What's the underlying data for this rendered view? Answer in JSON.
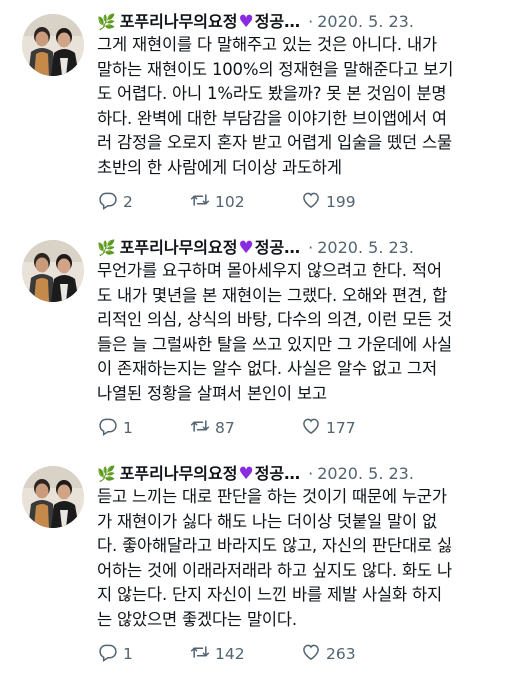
{
  "tweets": [
    {
      "icon": "leaf-emoji",
      "author_prefix": "포푸리나무의요정",
      "author_suffix": "정공",
      "ellipsis": "…",
      "separator": "·",
      "date": "2020. 5. 23.",
      "lines": [
        "그게 재현이를 다 말해주고 있는 것은 아니다. 내가",
        "말하는 재현이도 100%의 정재현을 말해준다고 보기",
        "도 어렵다. 아니 1%라도 봤을까? 못 본 것임이 분명",
        "하다. 완벽에 대한 부담감을 이야기한 브이앱에서 여",
        "러 감정을 오로지 혼자 받고 어렵게 입술을 뗐던 스물",
        "초반의 한 사람에게 더이상 과도하게"
      ],
      "replies": "2",
      "retweets": "102",
      "likes": "199"
    },
    {
      "icon": "leaf-emoji",
      "author_prefix": "포푸리나무의요정",
      "author_suffix": "정공",
      "ellipsis": "…",
      "separator": "·",
      "date": "2020. 5. 23.",
      "lines": [
        "무언가를 요구하며 몰아세우지 않으려고 한다. 적어",
        "도 내가 몇년을 본 재현이는 그랬다. 오해와 편견, 합",
        "리적인 의심, 상식의 바탕, 다수의 의견, 이런 모든 것",
        "들은 늘 그럴싸한 탈을 쓰고 있지만 그 가운데에 사실",
        "이 존재하는지는 알수 없다. 사실은 알수 없고 그저",
        "나열된 정황을 살펴서 본인이 보고"
      ],
      "replies": "1",
      "retweets": "87",
      "likes": "177"
    },
    {
      "icon": "leaf-emoji",
      "author_prefix": "포푸리나무의요정",
      "author_suffix": "정공",
      "ellipsis": "…",
      "separator": "·",
      "date": "2020. 5. 23.",
      "lines": [
        "듣고 느끼는 대로 판단을 하는 것이기 때문에 누군가",
        "가 재현이가 싫다 해도 나는 더이상 덧붙일 말이 없",
        "다. 좋아해달라고 바라지도 않고, 자신의 판단대로 싫",
        "어하는 것에 이래라저래라 하고 싶지도 않다. 화도 나",
        "지 않는다. 단지 자신이 느낀 바를 제발 사실화 하지",
        "는 않았으면 좋겠다는 말이다."
      ],
      "replies": "1",
      "retweets": "142",
      "likes": "263"
    }
  ],
  "colors": {
    "text": "#0f1419",
    "muted": "#536471",
    "heart": "#8a2be2",
    "background": "#ffffff"
  },
  "icons": {
    "reply": "reply-icon",
    "retweet": "retweet-icon",
    "like": "like-icon"
  }
}
